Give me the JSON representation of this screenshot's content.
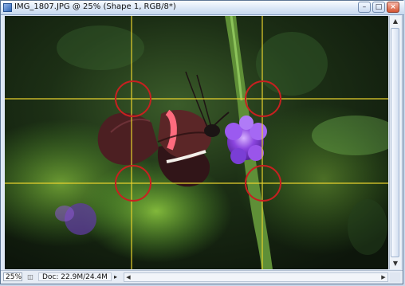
{
  "window": {
    "title": "IMG_1807.JPG @ 25% (Shape 1, RGB/8*)",
    "buttons": {
      "minimize": "–",
      "maximize": "□",
      "close": "×"
    }
  },
  "canvas": {
    "description_icon": "document-icon",
    "guide_color": "#e6d02d",
    "circle_color": "#c82020"
  },
  "status": {
    "zoom": "25%",
    "doc_info": "Doc: 22.9M/24.4M",
    "arrow": "▸"
  },
  "scroll": {
    "up": "▲",
    "down": "▼",
    "left": "◀",
    "right": "▶"
  }
}
